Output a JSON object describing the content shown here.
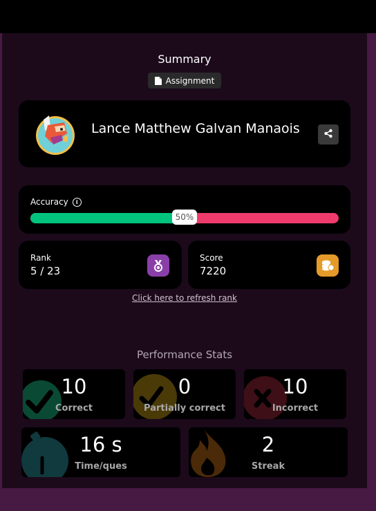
{
  "header": {
    "title": "Summary",
    "mode_label": "Assignment"
  },
  "player": {
    "name": "Lance Matthew Galvan Manaois"
  },
  "accuracy": {
    "label": "Accuracy",
    "percent": 50,
    "percent_text": "50%"
  },
  "rank": {
    "label": "Rank",
    "value": "5 / 23"
  },
  "score": {
    "label": "Score",
    "value": "7220"
  },
  "refresh_text": "Click here to refresh rank",
  "performance": {
    "title": "Performance Stats",
    "correct": {
      "value": "10",
      "label": "Correct"
    },
    "partial": {
      "value": "0",
      "label": "Partially correct"
    },
    "incorrect": {
      "value": "10",
      "label": "Incorrect"
    },
    "time": {
      "value": "16 s",
      "label": "Time/ques"
    },
    "streak": {
      "value": "2",
      "label": "Streak"
    }
  },
  "colors": {
    "correct": "#00c47d",
    "incorrect": "#ee3b6c",
    "rank_icon_bg": "#8a3fa8",
    "score_icon_bg": "#e49b2a"
  },
  "icons": {
    "document": "document-icon",
    "info": "info-icon",
    "share": "share-icon",
    "medal": "medal-icon",
    "coins": "coins-icon",
    "check": "check-icon",
    "cross": "cross-icon",
    "timer": "stopwatch-icon",
    "flame": "flame-icon"
  }
}
